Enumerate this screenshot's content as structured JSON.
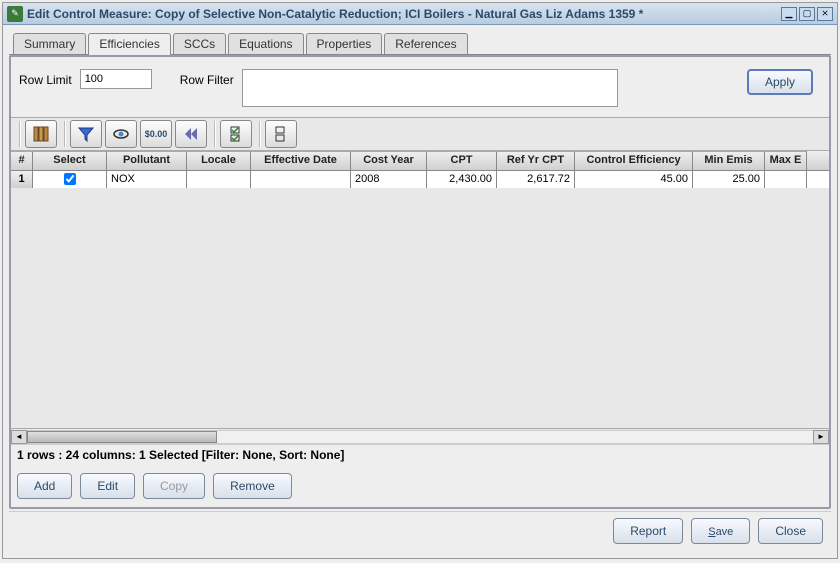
{
  "window": {
    "title": "Edit Control Measure: Copy of Selective Non-Catalytic Reduction; ICI Boilers - Natural Gas Liz Adams 1359 *"
  },
  "tabs": [
    {
      "label": "Summary"
    },
    {
      "label": "Efficiencies"
    },
    {
      "label": "SCCs"
    },
    {
      "label": "Equations"
    },
    {
      "label": "Properties"
    },
    {
      "label": "References"
    }
  ],
  "activeTab": 1,
  "filter": {
    "rowLimitLabel": "Row Limit",
    "rowLimitValue": "100",
    "rowFilterLabel": "Row Filter",
    "rowFilterValue": "",
    "applyLabel": "Apply"
  },
  "columns": {
    "rownum": "#",
    "select": "Select",
    "pollutant": "Pollutant",
    "locale": "Locale",
    "effectiveDate": "Effective Date",
    "costYear": "Cost Year",
    "cpt": "CPT",
    "refYrCpt": "Ref Yr CPT",
    "controlEfficiency": "Control Efficiency",
    "minEmis": "Min Emis",
    "maxEmis": "Max E"
  },
  "rows": [
    {
      "rownum": "1",
      "select": true,
      "pollutant": "NOX",
      "locale": "",
      "effectiveDate": "",
      "costYear": "2008",
      "cpt": "2,430.00",
      "refYrCpt": "2,617.72",
      "controlEfficiency": "45.00",
      "minEmis": "25.00",
      "maxEmis": ""
    }
  ],
  "status": "1 rows : 24 columns: 1 Selected [Filter: None, Sort: None]",
  "crud": {
    "add": "Add",
    "edit": "Edit",
    "copy": "Copy",
    "remove": "Remove"
  },
  "footer": {
    "report": "Report",
    "save": "Save",
    "close": "Close"
  },
  "toolbarIcons": [
    "columns",
    "filter",
    "view",
    "format-cost",
    "first",
    "select-all",
    "clear-all"
  ]
}
